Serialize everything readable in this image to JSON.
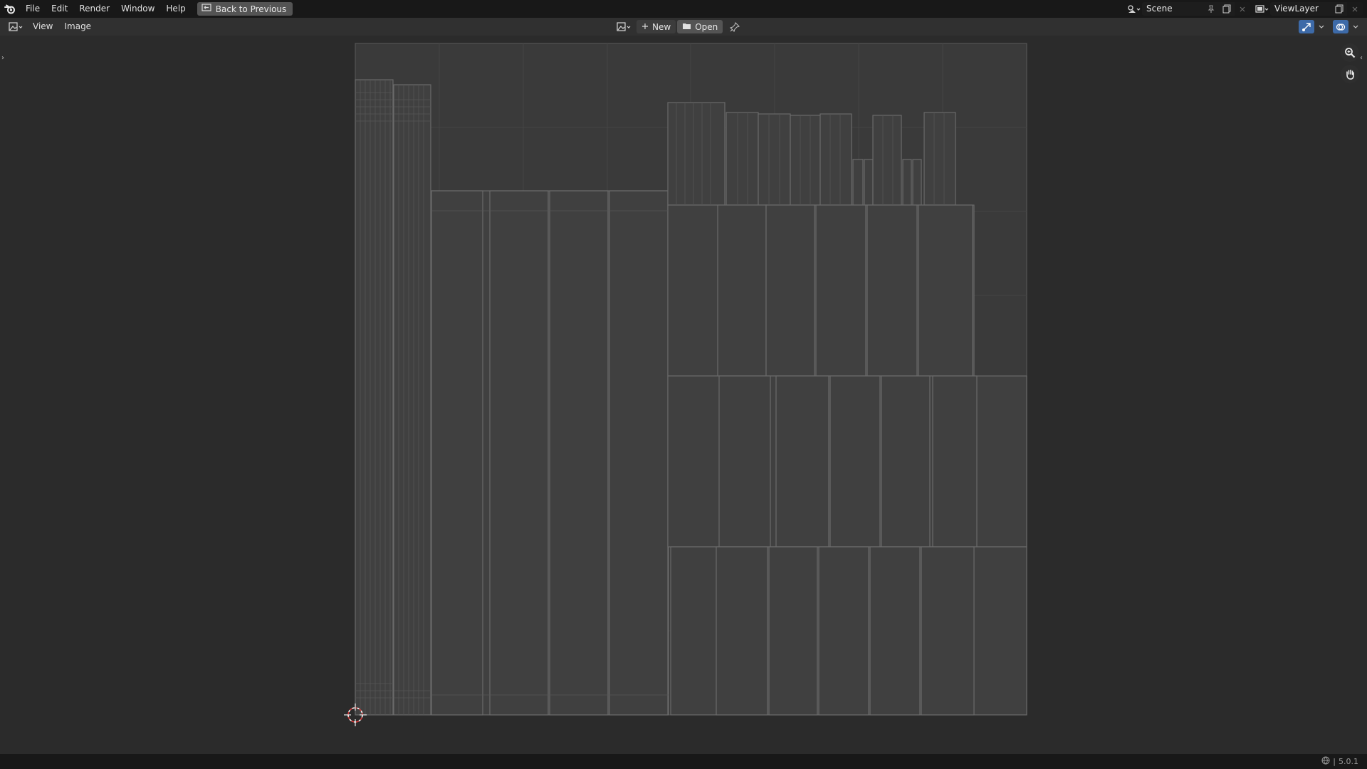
{
  "topbar": {
    "menus": [
      "File",
      "Edit",
      "Render",
      "Window",
      "Help"
    ],
    "back_button": "Back to Previous",
    "scene": "Scene",
    "view_layer": "ViewLayer"
  },
  "header": {
    "menus": [
      "View",
      "Image"
    ],
    "new_label": "New",
    "open_label": "Open"
  },
  "icons": {
    "logo": "blender-logo-icon",
    "back": "back-to-previous-icon",
    "scene_selector": "scene-icon",
    "view_layer_selector": "view-layer-icon",
    "editor_type": "image-editor-icon",
    "image_browse": "image-browse-icon",
    "new": "plus-icon",
    "open": "folder-icon",
    "pin": "pin-icon",
    "gizmo_toggle": "gizmo-icon",
    "overlay_toggle": "overlay-icon",
    "zoom": "zoom-icon",
    "pan": "hand-icon",
    "cursor": "2d-cursor-icon",
    "network": "network-icon"
  },
  "colors": {
    "topbar_bg": "#181818",
    "header_bg": "#303030",
    "viewport_bg": "#2b2b2b",
    "uv_canvas_bg": "#3c3c3c",
    "accent_blue": "#3d6aa8"
  },
  "statusbar": {
    "version": "5.0.1"
  }
}
